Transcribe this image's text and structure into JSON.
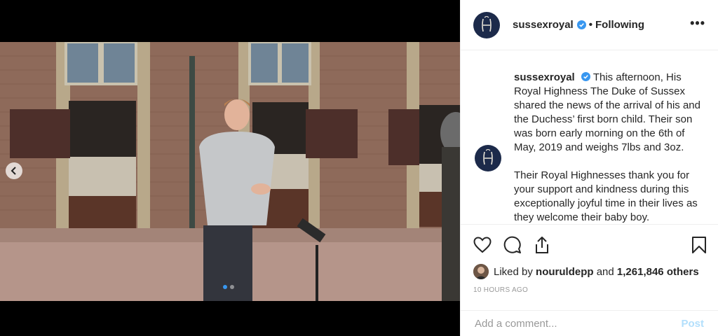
{
  "header": {
    "username": "sussexroyal",
    "separator": "•",
    "follow_label": "Following",
    "more_label": "•••"
  },
  "post": {
    "author": "sussexroyal",
    "caption_p1": "This afternoon, His Royal Highness The Duke of Sussex shared the news of the arrival of his and the Duchess’ first born child. Their son was born early morning on the 6th of May, 2019 and weighs 7lbs and 3oz.",
    "caption_p2": "Their Royal Highnesses thank you for your support and kindness during this exceptionally joyful time in their lives as they welcome their baby boy."
  },
  "likes": {
    "prefix": "Liked by",
    "liker": "nouruldepp",
    "connector": "and",
    "count_text": "1,261,846 others"
  },
  "timestamp": "10 HOURS AGO",
  "comment_box": {
    "placeholder": "Add a comment...",
    "post_label": "Post"
  },
  "carousel": {
    "current_index": 1,
    "total": 2
  },
  "colors": {
    "verified": "#3897f0",
    "post_disabled": "#b2dffc",
    "avatar_bg": "#1c2a4a"
  },
  "icons": {
    "like": "heart-icon",
    "comment": "comment-icon",
    "share": "share-icon",
    "save": "bookmark-icon",
    "prev": "chevron-left-icon"
  }
}
